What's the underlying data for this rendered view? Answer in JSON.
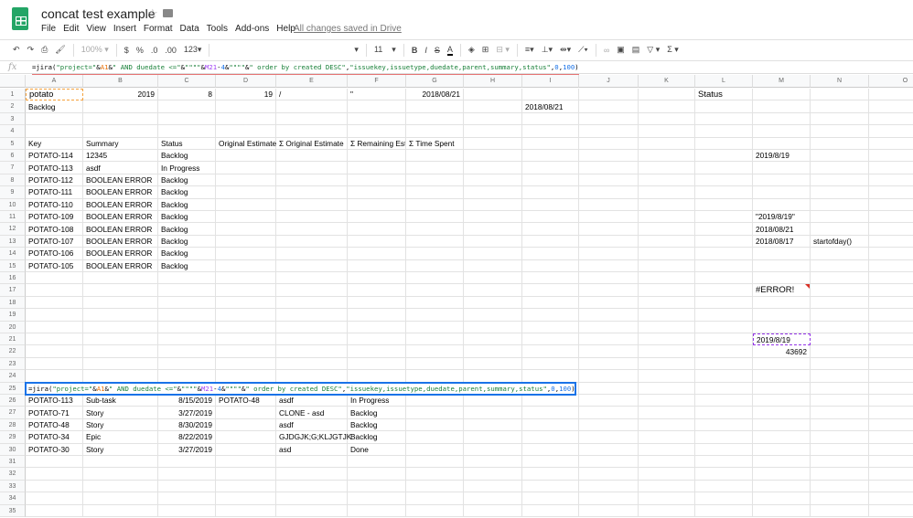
{
  "title": "concat test example",
  "menu": [
    "File",
    "Edit",
    "View",
    "Insert",
    "Format",
    "Data",
    "Tools",
    "Add-ons",
    "Help"
  ],
  "saved_status": "All changes saved in Drive",
  "toolbar": {
    "zoom": "100%",
    "currency": "$",
    "percent": "%",
    "dec_less": ".0",
    "dec_more": ".00",
    "format": "123",
    "font_size": "11",
    "bold": "B",
    "italic": "I",
    "strike": "S",
    "text_color": "A",
    "sum": "Σ"
  },
  "formula_label": "fx",
  "formula_tokens": [
    {
      "t": "=jira(",
      "c": "#000000"
    },
    {
      "t": "\"project=\"",
      "c": "#188038"
    },
    {
      "t": "&",
      "c": "#000000"
    },
    {
      "t": "A1",
      "c": "#e8710a"
    },
    {
      "t": "&",
      "c": "#000000"
    },
    {
      "t": "\" AND duedate <=\"",
      "c": "#188038"
    },
    {
      "t": "&",
      "c": "#000000"
    },
    {
      "t": "\"\"\"\"",
      "c": "#188038"
    },
    {
      "t": "&",
      "c": "#000000"
    },
    {
      "t": "M21",
      "c": "#a142f4"
    },
    {
      "t": "-",
      "c": "#000000"
    },
    {
      "t": "4",
      "c": "#1a73e8"
    },
    {
      "t": "&",
      "c": "#000000"
    },
    {
      "t": "\"\"\"\"",
      "c": "#188038"
    },
    {
      "t": "&",
      "c": "#000000"
    },
    {
      "t": "\" order by created DESC\"",
      "c": "#188038"
    },
    {
      "t": ",",
      "c": "#000000"
    },
    {
      "t": "\"issuekey,issuetype,duedate,parent,summary,status\"",
      "c": "#188038"
    },
    {
      "t": ",",
      "c": "#000000"
    },
    {
      "t": "0",
      "c": "#1a73e8"
    },
    {
      "t": ",",
      "c": "#000000"
    },
    {
      "t": "100",
      "c": "#1a73e8"
    },
    {
      "t": ")",
      "c": "#000000"
    }
  ],
  "columns": [
    "A",
    "B",
    "C",
    "D",
    "E",
    "F",
    "G",
    "H",
    "I",
    "J",
    "K",
    "L",
    "M",
    "N",
    "O"
  ],
  "row_count": 35,
  "cells": {
    "A1": "potato",
    "B1": "2019",
    "C1": "8",
    "D1": "19",
    "E1": "/",
    "F1": "\"",
    "G1": "2018/08/21",
    "L1": "Status",
    "A2": "Backlog",
    "I2": "2018/08/21",
    "A5": "Key",
    "B5": "Summary",
    "C5": "Status",
    "D5": "Original Estimate",
    "E5": "Σ Original Estimate",
    "F5": "Σ Remaining Esti",
    "G5": "Σ Time Spent",
    "A6": "POTATO-114",
    "B6": "12345",
    "C6": "Backlog",
    "M6": "2019/8/19",
    "A7": "POTATO-113",
    "B7": "asdf",
    "C7": "In Progress",
    "A8": "POTATO-112",
    "B8": "BOOLEAN ERROR",
    "C8": "Backlog",
    "A9": "POTATO-111",
    "B9": "BOOLEAN ERROR",
    "C9": "Backlog",
    "A10": "POTATO-110",
    "B10": "BOOLEAN ERROR",
    "C10": "Backlog",
    "A11": "POTATO-109",
    "B11": "BOOLEAN ERROR",
    "C11": "Backlog",
    "M11": "\"2019/8/19\"",
    "A12": "POTATO-108",
    "B12": "BOOLEAN ERROR",
    "C12": "Backlog",
    "M12": "2018/08/21",
    "A13": "POTATO-107",
    "B13": "BOOLEAN ERROR",
    "C13": "Backlog",
    "M13": "2018/08/17",
    "N13": "startofday()",
    "A14": "POTATO-106",
    "B14": "BOOLEAN ERROR",
    "C14": "Backlog",
    "A15": "POTATO-105",
    "B15": "BOOLEAN ERROR",
    "C15": "Backlog",
    "M17": "#ERROR!",
    "M21": "2019/8/19",
    "M22": "43692",
    "A26": "POTATO-113",
    "B26": "Sub-task",
    "C26": "8/15/2019",
    "D26": "POTATO-48",
    "E26": "asdf",
    "F26": "In Progress",
    "A27": "POTATO-71",
    "B27": "Story",
    "C27": "3/27/2019",
    "E27": "CLONE - asd",
    "F27": "Backlog",
    "A28": "POTATO-48",
    "B28": "Story",
    "C28": "8/30/2019",
    "E28": "asdf",
    "F28": "Backlog",
    "A29": "POTATO-34",
    "B29": "Epic",
    "C29": "8/22/2019",
    "E29": "GJDGJK;G;KLJGTJK",
    "F29": "Backlog",
    "A30": "POTATO-30",
    "B30": "Story",
    "C30": "3/27/2019",
    "E30": "asd",
    "F30": "Done"
  }
}
